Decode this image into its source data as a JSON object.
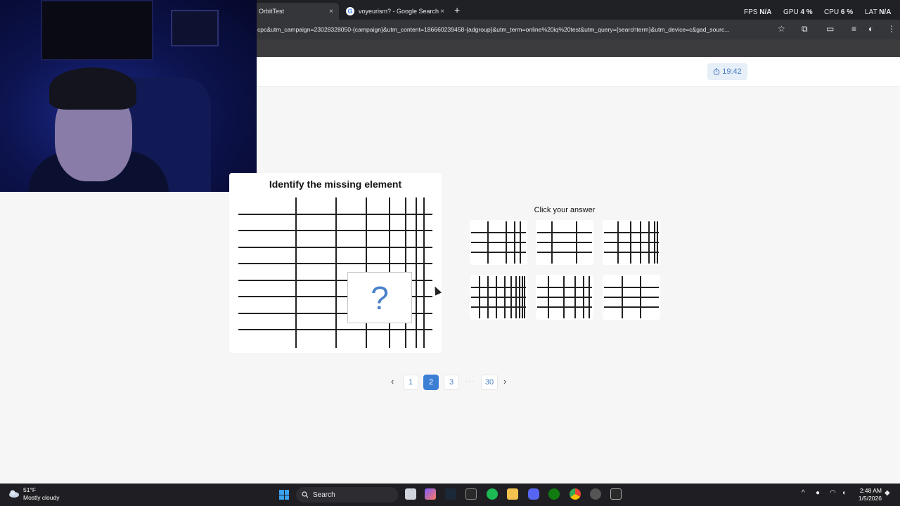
{
  "browser": {
    "tabs": [
      {
        "title": "OrbitTest",
        "close": "×"
      },
      {
        "title": "voyeurism? - Google Search",
        "close": "×",
        "favicon": "G"
      }
    ],
    "new_tab": "+",
    "url": "cpc&utm_campaign=23028328050-{campaign}&utm_content=186660239458-{adgroup}&utm_term=online%20iq%20test&utm_query={searchterm}&utm_device=c&gad_sourc...",
    "overlay": {
      "fps_label": "FPS",
      "fps_value": "N/A",
      "gpu_label": "GPU",
      "gpu_value": "4 %",
      "cpu_label": "CPU",
      "cpu_value": "6 %",
      "lat_label": "LAT",
      "lat_value": "N/A"
    }
  },
  "header": {
    "timer": "19:42",
    "timer_icon": "stopwatch-icon"
  },
  "question": {
    "title": "Identify the missing element",
    "missing_symbol": "?"
  },
  "answers": {
    "title": "Click your answer",
    "options": [
      {
        "id": "A"
      },
      {
        "id": "B"
      },
      {
        "id": "C"
      },
      {
        "id": "D"
      },
      {
        "id": "E"
      },
      {
        "id": "F"
      }
    ]
  },
  "pagination": {
    "prev": "‹",
    "pages": [
      "1",
      "2",
      "3"
    ],
    "current": "2",
    "ellipsis": "···",
    "last": "30",
    "next": "›"
  },
  "taskbar": {
    "weather_temp": "51°F",
    "weather_desc": "Mostly cloudy",
    "search_label": "Search",
    "time": "2:48 AM",
    "date": "1/5/2026"
  },
  "colors": {
    "accent": "#3b7fd4",
    "timer_bg": "#e6eef8",
    "chrome_dark": "#202124"
  }
}
